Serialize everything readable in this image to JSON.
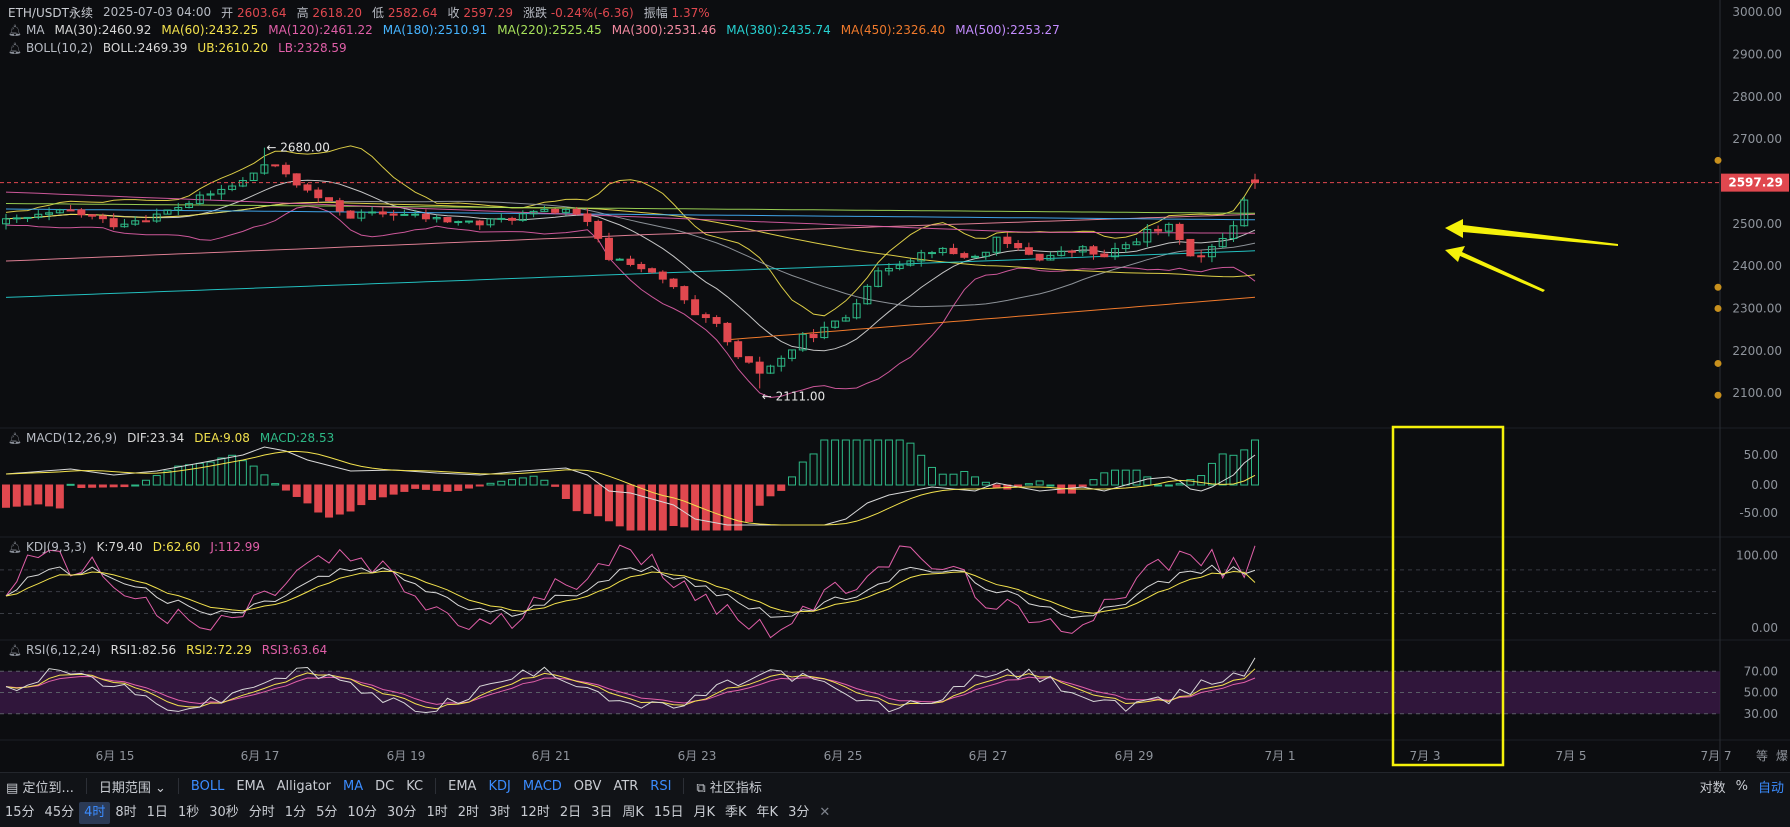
{
  "header": {
    "symbol": "ETH/USDT永续",
    "datetime": "2025-07-03 04:00",
    "open_label": "开",
    "open": "2603.64",
    "high_label": "高",
    "high": "2618.20",
    "low_label": "低",
    "low": "2582.64",
    "close_label": "收",
    "close": "2597.29",
    "change_label": "涨跌",
    "change": "-0.24%(-6.36)",
    "amp_label": "振幅",
    "amp": "1.37%"
  },
  "ma_line": {
    "name": "MA",
    "items": [
      {
        "text": "MA(30):2460.92",
        "color": "#d8d8d8"
      },
      {
        "text": "MA(60):2432.25",
        "color": "#f2e14d"
      },
      {
        "text": "MA(120):2461.22",
        "color": "#e05fa8"
      },
      {
        "text": "MA(180):2510.91",
        "color": "#46b4ff"
      },
      {
        "text": "MA(220):2525.45",
        "color": "#a6e05a"
      },
      {
        "text": "MA(300):2531.46",
        "color": "#f28aa0"
      },
      {
        "text": "MA(380):2435.74",
        "color": "#26d1d1"
      },
      {
        "text": "MA(450):2326.40",
        "color": "#f07a2c"
      },
      {
        "text": "MA(500):2253.27",
        "color": "#c48cff"
      }
    ]
  },
  "boll_line": {
    "name": "BOLL(10,2)",
    "items": [
      {
        "text": "BOLL:2469.39",
        "color": "#d8d8d8"
      },
      {
        "text": "UB:2610.20",
        "color": "#f2e14d"
      },
      {
        "text": "LB:2328.59",
        "color": "#e05fa8"
      }
    ]
  },
  "macd_line": {
    "name": "MACD(12,26,9)",
    "items": [
      {
        "text": "DIF:23.34",
        "color": "#d8d8d8"
      },
      {
        "text": "DEA:9.08",
        "color": "#f2e14d"
      },
      {
        "text": "MACD:28.53",
        "color": "#2eb886"
      }
    ]
  },
  "kdj_line": {
    "name": "KDJ(9,3,3)",
    "items": [
      {
        "text": "K:79.40",
        "color": "#d8d8d8"
      },
      {
        "text": "D:62.60",
        "color": "#f2e14d"
      },
      {
        "text": "J:112.99",
        "color": "#e05fa8"
      }
    ]
  },
  "rsi_line": {
    "name": "RSI(6,12,24)",
    "items": [
      {
        "text": "RSI1:82.56",
        "color": "#d8d8d8"
      },
      {
        "text": "RSI2:72.29",
        "color": "#f2e14d"
      },
      {
        "text": "RSI3:63.64",
        "color": "#e05fa8"
      }
    ]
  },
  "price_axis": [
    "3000.00",
    "2900.00",
    "2800.00",
    "2700.00",
    "2600.00",
    "2500.00",
    "2400.00",
    "2300.00",
    "2200.00",
    "2100.00"
  ],
  "current_price": "2597.29",
  "macd_axis": [
    "50.00",
    "0.00",
    "-50.00"
  ],
  "kdj_axis": [
    "100.00",
    "0.00"
  ],
  "rsi_axis": [
    "70.00",
    "50.00",
    "30.00"
  ],
  "date_axis": [
    "6月 15",
    "6月 17",
    "6月 19",
    "6月 21",
    "6月 23",
    "6月 25",
    "6月 27",
    "6月 29",
    "7月 1",
    "7月 3",
    "7月 5",
    "7月 7"
  ],
  "axis_corner": [
    "等",
    "爆"
  ],
  "annotations": {
    "high_mark": "2680.00",
    "low_mark": "2111.00"
  },
  "colors": {
    "up": "#2eb886",
    "down": "#e0484f",
    "highlight": "#f5f10a",
    "accent": "#3b8cff"
  },
  "toolbar1": {
    "locate": "定位到...",
    "date_range": "日期范围",
    "main_indicators": [
      "BOLL",
      "EMA",
      "Alligator",
      "MA",
      "DC",
      "KC"
    ],
    "main_active": [
      "BOLL",
      "MA"
    ],
    "sub_indicators": [
      "EMA",
      "KDJ",
      "MACD",
      "OBV",
      "ATR",
      "RSI"
    ],
    "sub_active": [
      "KDJ",
      "MACD",
      "RSI"
    ],
    "community": "社区指标",
    "right": [
      "对数",
      "%",
      "自动"
    ]
  },
  "timeframes": [
    "15分",
    "45分",
    "4时",
    "8时",
    "1日",
    "1秒",
    "30秒",
    "分时",
    "1分",
    "5分",
    "10分",
    "30分",
    "1时",
    "2时",
    "3时",
    "12时",
    "2日",
    "3日",
    "周K",
    "15日",
    "月K",
    "季K",
    "年K",
    "3分"
  ],
  "active_timeframe": "4时",
  "chart_data": {
    "type": "candlestick",
    "interval": "4h",
    "series_names": [
      "MA(30)",
      "MA(60)",
      "MA(120)",
      "MA(180)",
      "MA(220)",
      "MA(300)",
      "MA(380)",
      "MA(450)",
      "MA(500)",
      "BOLL",
      "UB",
      "LB"
    ],
    "price_range": [
      2060,
      3010
    ],
    "key_points": [
      {
        "date": "6月 17",
        "price": 2680.0,
        "label": "high"
      },
      {
        "date": "6月 23",
        "price": 2111.0,
        "label": "low"
      }
    ],
    "last": {
      "open": 2603.64,
      "high": 2618.2,
      "low": 2582.64,
      "close": 2597.29
    },
    "macd": {
      "dif": 23.34,
      "dea": 9.08,
      "hist": 28.53,
      "range": [
        -80,
        80
      ]
    },
    "kdj": {
      "k": 79.4,
      "d": 62.6,
      "j": 112.99
    },
    "rsi": {
      "rsi1": 82.56,
      "rsi2": 72.29,
      "rsi3": 63.64
    }
  }
}
